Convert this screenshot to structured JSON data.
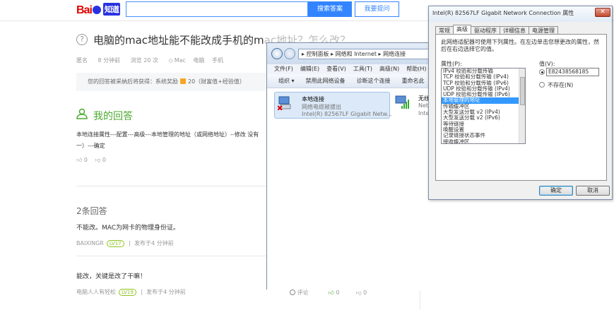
{
  "header": {
    "logo_text": "Bai",
    "logo_text2": "知道",
    "search_value": "",
    "search_button": "搜索答案",
    "ask_button": "我要提问"
  },
  "question": {
    "title": "电脑的mac地址能不能改成手机的m",
    "title_faded": "ac地址？怎么改？",
    "meta": [
      "匿名",
      "8 分钟前",
      "浏览 20 次",
      "Mac",
      "电脑",
      "手机"
    ],
    "reward_text": "您的回答被采纳后将获得：系统奖励",
    "reward_amount": "20（财富值+经验值）"
  },
  "my_answer": {
    "heading": "我的回答",
    "text": "本地连接属性---配置---高级---本地管理的地址（或网络地址）--修改 没有一）---确定",
    "up": "0",
    "down": "0"
  },
  "answers": {
    "count_label": "2条回答",
    "items": [
      {
        "text": "不能改。MAC为网卡的物理身份证。",
        "author": "BAIXINGR",
        "level": "LV17",
        "time": "发布于4 分钟前"
      },
      {
        "text": "能改，关键是改了干嘛！",
        "author": "电脑人人有轻松",
        "level": "LV19",
        "time": "发布于4 分钟前"
      }
    ],
    "comment_label": "评论",
    "up": "0",
    "down": "0"
  },
  "explorer": {
    "breadcrumb": "▸ 控制面板 ▸ 网络和 Internet ▸ 网络连接",
    "menu": [
      "文件(F)",
      "编辑(E)",
      "查看(V)",
      "工具(T)",
      "高级(N)",
      "帮助(H)"
    ],
    "commands": [
      "组织 ▾",
      "禁用此网络设备",
      "诊断这个连接",
      "重命名此"
    ],
    "connections": [
      {
        "name": "本地连接",
        "status": "网络电缆被拔出",
        "device": "Intel(R) 82567LF Gigabit Netw..."
      },
      {
        "name": "无线网",
        "status": "Netw",
        "device": "Intel"
      }
    ]
  },
  "dialog": {
    "title": "Intel(R) 82567LF Gigabit Network Connection 属性",
    "close": "✕",
    "tabs": [
      "常规",
      "高级",
      "驱动程序",
      "详细信息",
      "电源管理"
    ],
    "active_tab": "高级",
    "description": "此网络适配器可使用下列属性。在左边单击您想更改的属性，然后在右边选择它的值。",
    "property_label": "属性(P):",
    "value_label": "值(V):",
    "properties": [
      "IPv4 校验和分载传输",
      "TCP 校验和分载传输 (IPv4)",
      "TCP 校验和分载传输 (IPv6)",
      "UDP 校验和分载传输 (IPv4)",
      "UDP 校验和分载传输 (IPv6)",
      "本地管理的地址",
      "传输缓冲区",
      "大型发送分载 v2 (IPv4)",
      "大型发送分载 v2 (IPv6)",
      "等待链接",
      "唤醒设置",
      "记录链接状态事件",
      "接收缓冲区",
      "巨帧数据包"
    ],
    "selected_index": 5,
    "value": "E82438568185",
    "not_present": "不存在(N)",
    "ok": "确定",
    "cancel": "取消"
  }
}
